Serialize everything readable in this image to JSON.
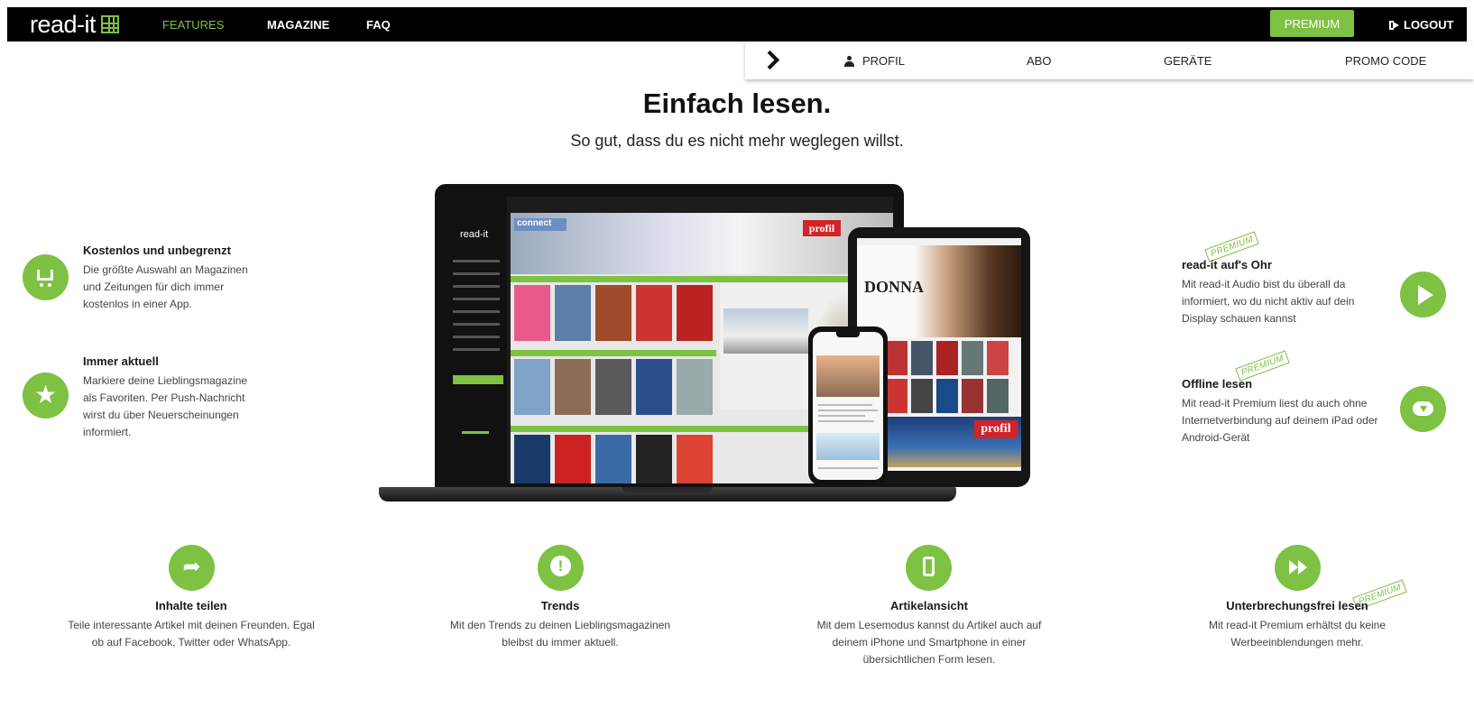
{
  "nav": {
    "logo_text": "read-it",
    "links": [
      "FEATURES",
      "MAGAZINE",
      "FAQ"
    ],
    "premium_label": "PREMIUM",
    "logout_label": "LOGOUT",
    "accent_color": "#7dc242"
  },
  "subnav": {
    "items": [
      "PROFIL",
      "ABO",
      "GERÄTE",
      "PROMO CODE"
    ]
  },
  "hero": {
    "title": "Einfach lesen.",
    "subtitle": "So gut, dass du es nicht mehr weglegen willst."
  },
  "devices": {
    "laptop_brand": "read-it",
    "banner_left": "connect",
    "banner_right": "profil",
    "tablet_mag": "DONNA",
    "tablet_profil": "profil"
  },
  "features_left": [
    {
      "icon": "cart-icon",
      "title": "Kostenlos und unbegrenzt",
      "lines": [
        "Die größte Auswahl an Magazinen",
        "und Zeitungen für dich immer",
        "kostenlos in einer App."
      ]
    },
    {
      "icon": "star-icon",
      "title": "Immer aktuell",
      "lines": [
        "Markiere deine Lieblingsmagazine",
        "als Favoriten. Per Push-Nachricht",
        "wirst du über Neuerscheinungen",
        "informiert."
      ]
    }
  ],
  "features_right": [
    {
      "icon": "play-icon",
      "title": "read-it auf's Ohr",
      "badge": "PREMIUM",
      "lines": [
        "Mit read-it Audio bist du überall da",
        "informiert, wo du nicht aktiv auf dein",
        "Display schauen kannst"
      ]
    },
    {
      "icon": "cloud-download-icon",
      "title": "Offline lesen",
      "badge": "PREMIUM",
      "lines": [
        "Mit read-it Premium liest du auch ohne",
        "Internetverbindung auf deinem iPad oder",
        "Android-Gerät"
      ]
    }
  ],
  "features_bottom": [
    {
      "icon": "share-icon",
      "title": "Inhalte teilen",
      "lines": [
        "Teile interessante Artikel mit deinen Freunden. Egal",
        "ob auf Facebook, Twitter oder WhatsApp."
      ]
    },
    {
      "icon": "alert-icon",
      "title": "Trends",
      "lines": [
        "Mit den Trends zu deinen Lieblingsmagazinen",
        "bleibst du immer aktuell."
      ]
    },
    {
      "icon": "mobile-icon",
      "title": "Artikelansicht",
      "lines": [
        "Mit dem Lesemodus kannst du Artikel auch auf",
        "deinem iPhone und Smartphone in einer",
        "übersichtlichen Form lesen."
      ]
    },
    {
      "icon": "fast-forward-icon",
      "title": "Unterbrechungsfrei lesen",
      "badge": "PREMIUM",
      "lines": [
        "Mit read-it Premium erhältst du keine",
        "Werbeeinblendungen mehr."
      ]
    }
  ]
}
